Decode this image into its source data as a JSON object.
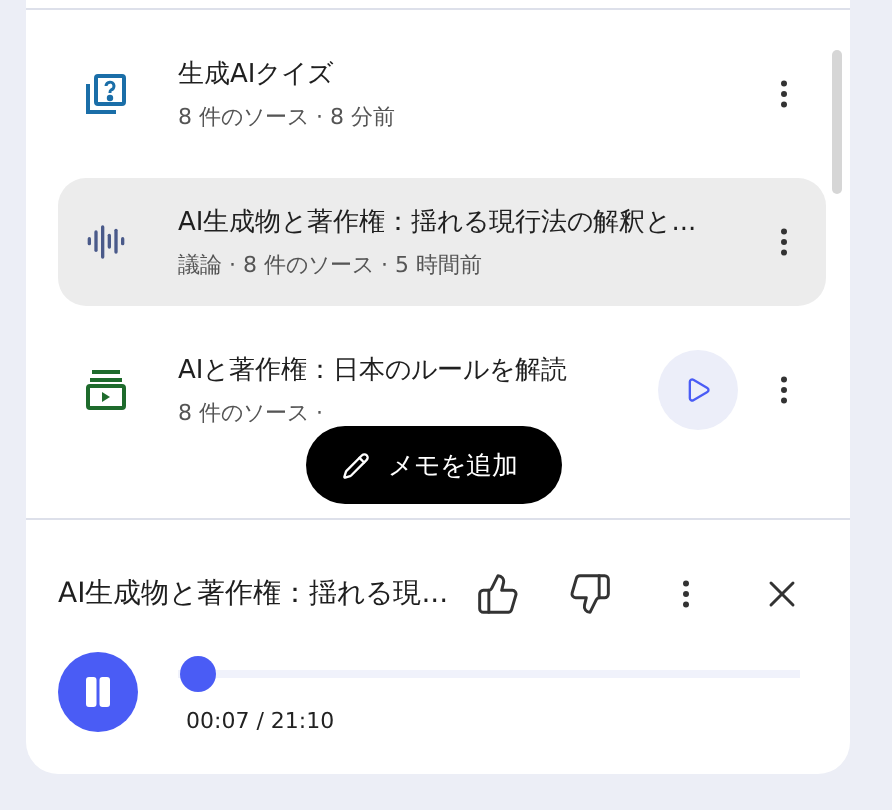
{
  "items": [
    {
      "kind": "quiz",
      "title": "生成AIクイズ",
      "meta": "8 件のソース · 8 分前",
      "selected": false,
      "playable": false
    },
    {
      "kind": "audio",
      "title": "AI生成物と著作権：揺れる現行法の解釈と...",
      "meta": "議論 · 8 件のソース · 5 時間前",
      "selected": true,
      "playable": false
    },
    {
      "kind": "video",
      "title": "AIと著作権：日本のルールを解読",
      "meta": "8 件のソース ·",
      "selected": false,
      "playable": true
    }
  ],
  "add_note_button": "メモを追加",
  "player": {
    "title": "AI生成物と著作権：揺れる現...",
    "playing": true,
    "level": 0.005,
    "time": "00:07 / 21:10"
  }
}
